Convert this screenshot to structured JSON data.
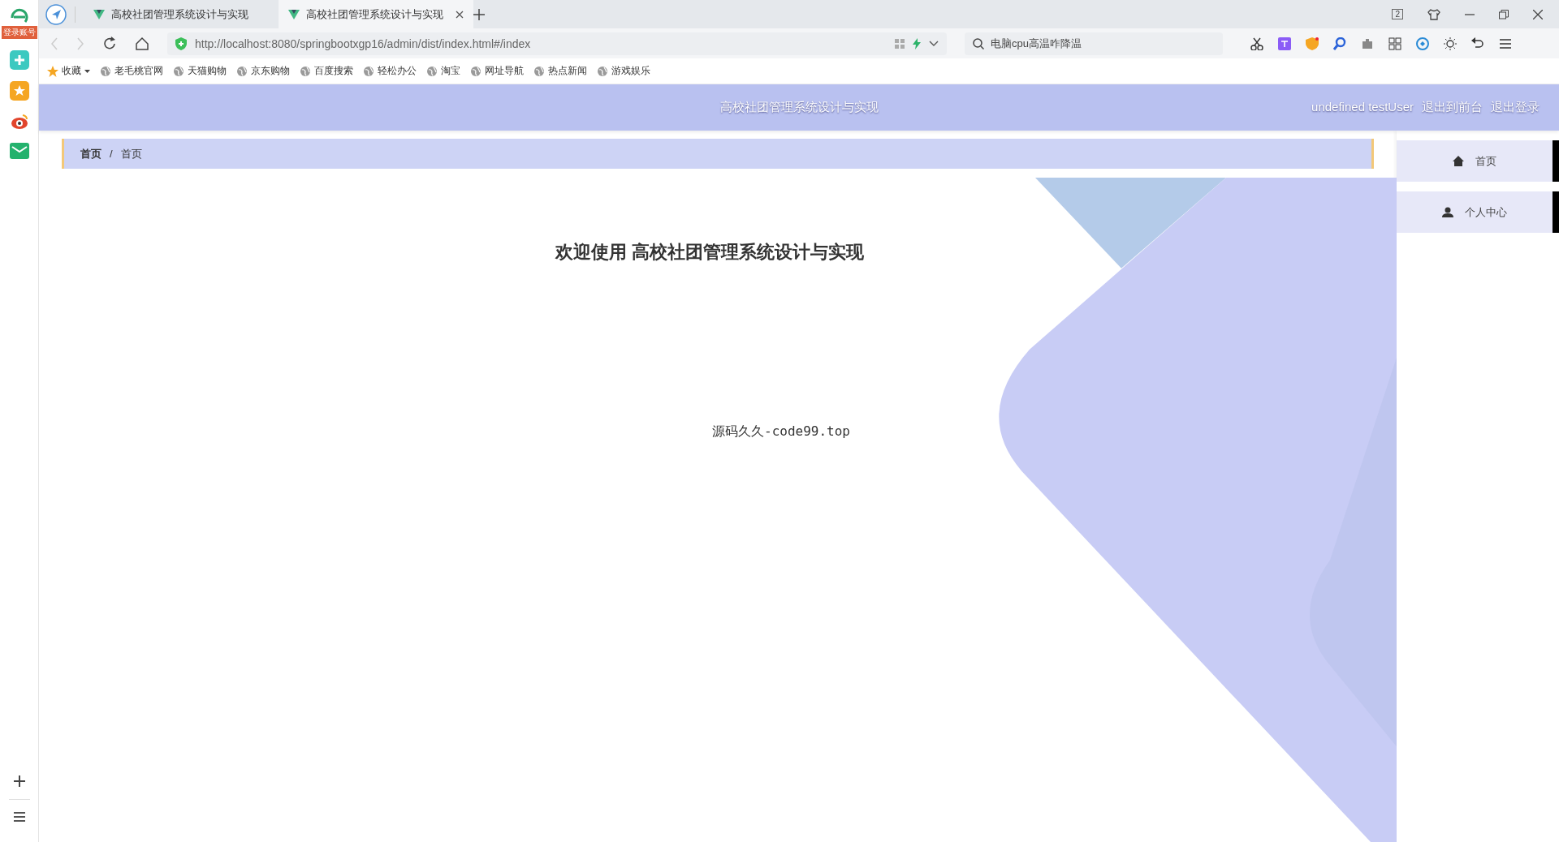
{
  "browser": {
    "login_badge": "登录账号",
    "tabs": [
      {
        "title": "高校社团管理系统设计与实现",
        "selected": false
      },
      {
        "title": "高校社团管理系统设计与实现",
        "selected": true
      }
    ],
    "tab_count": "2",
    "address": "http://localhost:8080/springbootxgp16/admin/dist/index.html#/index",
    "search": {
      "value": "电脑cpu高温咋降温"
    },
    "bookmarks_label": "收藏",
    "bookmarks": [
      "老毛桃官网",
      "天猫购物",
      "京东购物",
      "百度搜索",
      "轻松办公",
      "淘宝",
      "网址导航",
      "热点新闻",
      "游戏娱乐"
    ]
  },
  "header": {
    "title": "高校社团管理系统设计与实现",
    "user": "undefined testUser",
    "links": [
      "退出到前台",
      "退出登录"
    ]
  },
  "breadcrumb": [
    "首页",
    "首页"
  ],
  "separator": "/",
  "menu": [
    {
      "label": "首页",
      "kind": "home"
    },
    {
      "label": "个人中心",
      "kind": "user"
    }
  ],
  "welcome": {
    "title": "欢迎使用 高校社团管理系统设计与实现",
    "note": "源码久久-code99.top"
  }
}
